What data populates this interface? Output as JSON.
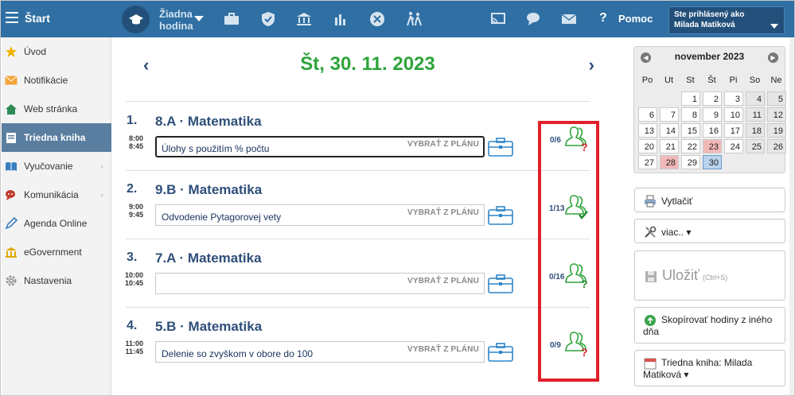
{
  "topbar": {
    "start_label": "Štart",
    "no_lesson_line1": "Žiadna",
    "no_lesson_line2": "hodina",
    "help_symbol": "?",
    "help_label": "Pomoc",
    "user_line1": "Ste prihlásený ako",
    "user_line2": "Milada Matiková",
    "icons": [
      "menu-icon",
      "graduation-cap-icon",
      "briefcase-icon",
      "shield-check-icon",
      "institution-icon",
      "bar-chart-icon",
      "no-entry-icon",
      "walking-people-icon",
      "cast-icon",
      "chat-icon",
      "mail-icon"
    ]
  },
  "sidebar": {
    "items": [
      {
        "label": "Úvod",
        "icon": "star-icon"
      },
      {
        "label": "Notifikácie",
        "icon": "envelope-icon"
      },
      {
        "label": "Web stránka",
        "icon": "home-icon"
      },
      {
        "label": "Triedna kniha",
        "icon": "book-icon",
        "active": true
      },
      {
        "label": "Vyučovanie",
        "icon": "open-book-icon",
        "has_submenu": true
      },
      {
        "label": "Komunikácia",
        "icon": "chat-icon",
        "has_submenu": true
      },
      {
        "label": "Agenda Online",
        "icon": "pen-icon"
      },
      {
        "label": "eGovernment",
        "icon": "institution-icon"
      },
      {
        "label": "Nastavenia",
        "icon": "gear-icon"
      }
    ]
  },
  "main": {
    "date_title": "Št, 30. 11. 2023",
    "prev_symbol": "‹",
    "next_symbol": "›",
    "lessons": [
      {
        "num": "1.",
        "title": "8.A · Matematika",
        "time_from": "8:00",
        "time_to": "8:45",
        "topic": "Úlohy s použitím % počtu",
        "plan_label": "VYBRAŤ Z PLÁNU",
        "attendance": "0/6",
        "status": "question",
        "focused": true
      },
      {
        "num": "2.",
        "title": "9.B · Matematika",
        "time_from": "9:00",
        "time_to": "9:45",
        "topic": "Odvodenie Pytagorovej vety",
        "plan_label": "VYBRAŤ Z PLÁNU",
        "attendance": "1/13",
        "status": "check"
      },
      {
        "num": "3.",
        "title": "7.A · Matematika",
        "time_from": "10:00",
        "time_to": "10:45",
        "topic": "",
        "plan_label": "VYBRAŤ Z PLÁNU",
        "attendance": "0/16",
        "status": "question-green"
      },
      {
        "num": "4.",
        "title": "5.B · Matematika",
        "time_from": "11:00",
        "time_to": "11:45",
        "topic": "Delenie so zvyškom v obore do 100",
        "plan_label": "VYBRAŤ Z PLÁNU",
        "attendance": "0/9",
        "status": "question"
      }
    ]
  },
  "calendar": {
    "month": "november 2023",
    "weekdays": [
      "Po",
      "Ut",
      "St",
      "Št",
      "Pi",
      "So",
      "Ne"
    ],
    "weeks": [
      [
        "",
        "",
        "1",
        "2",
        "3",
        "4",
        "5"
      ],
      [
        "6",
        "7",
        "8",
        "9",
        "10",
        "11",
        "12"
      ],
      [
        "13",
        "14",
        "15",
        "16",
        "17",
        "18",
        "19"
      ],
      [
        "20",
        "21",
        "22",
        "23",
        "24",
        "25",
        "26"
      ],
      [
        "27",
        "28",
        "29",
        "30",
        "",
        "",
        ""
      ]
    ],
    "highlighted": [
      "23",
      "28"
    ],
    "selected": "30"
  },
  "actions": {
    "print_label": "Vytlačiť",
    "more_label": "viac.. ▾",
    "save_label": "Uložiť",
    "save_hint": "(Ctrl+S)",
    "copy_line1": "Skopírovať hodiny z iného",
    "copy_line2": "dňa",
    "book_line1": "Triedna kniha: Milada",
    "book_line2": "Matiková ▾"
  },
  "colors": {
    "topbar": "#2f6fa3",
    "date_green": "#2ea43a",
    "title_blue": "#2f4f7a",
    "highlight_red": "#e0202a"
  }
}
